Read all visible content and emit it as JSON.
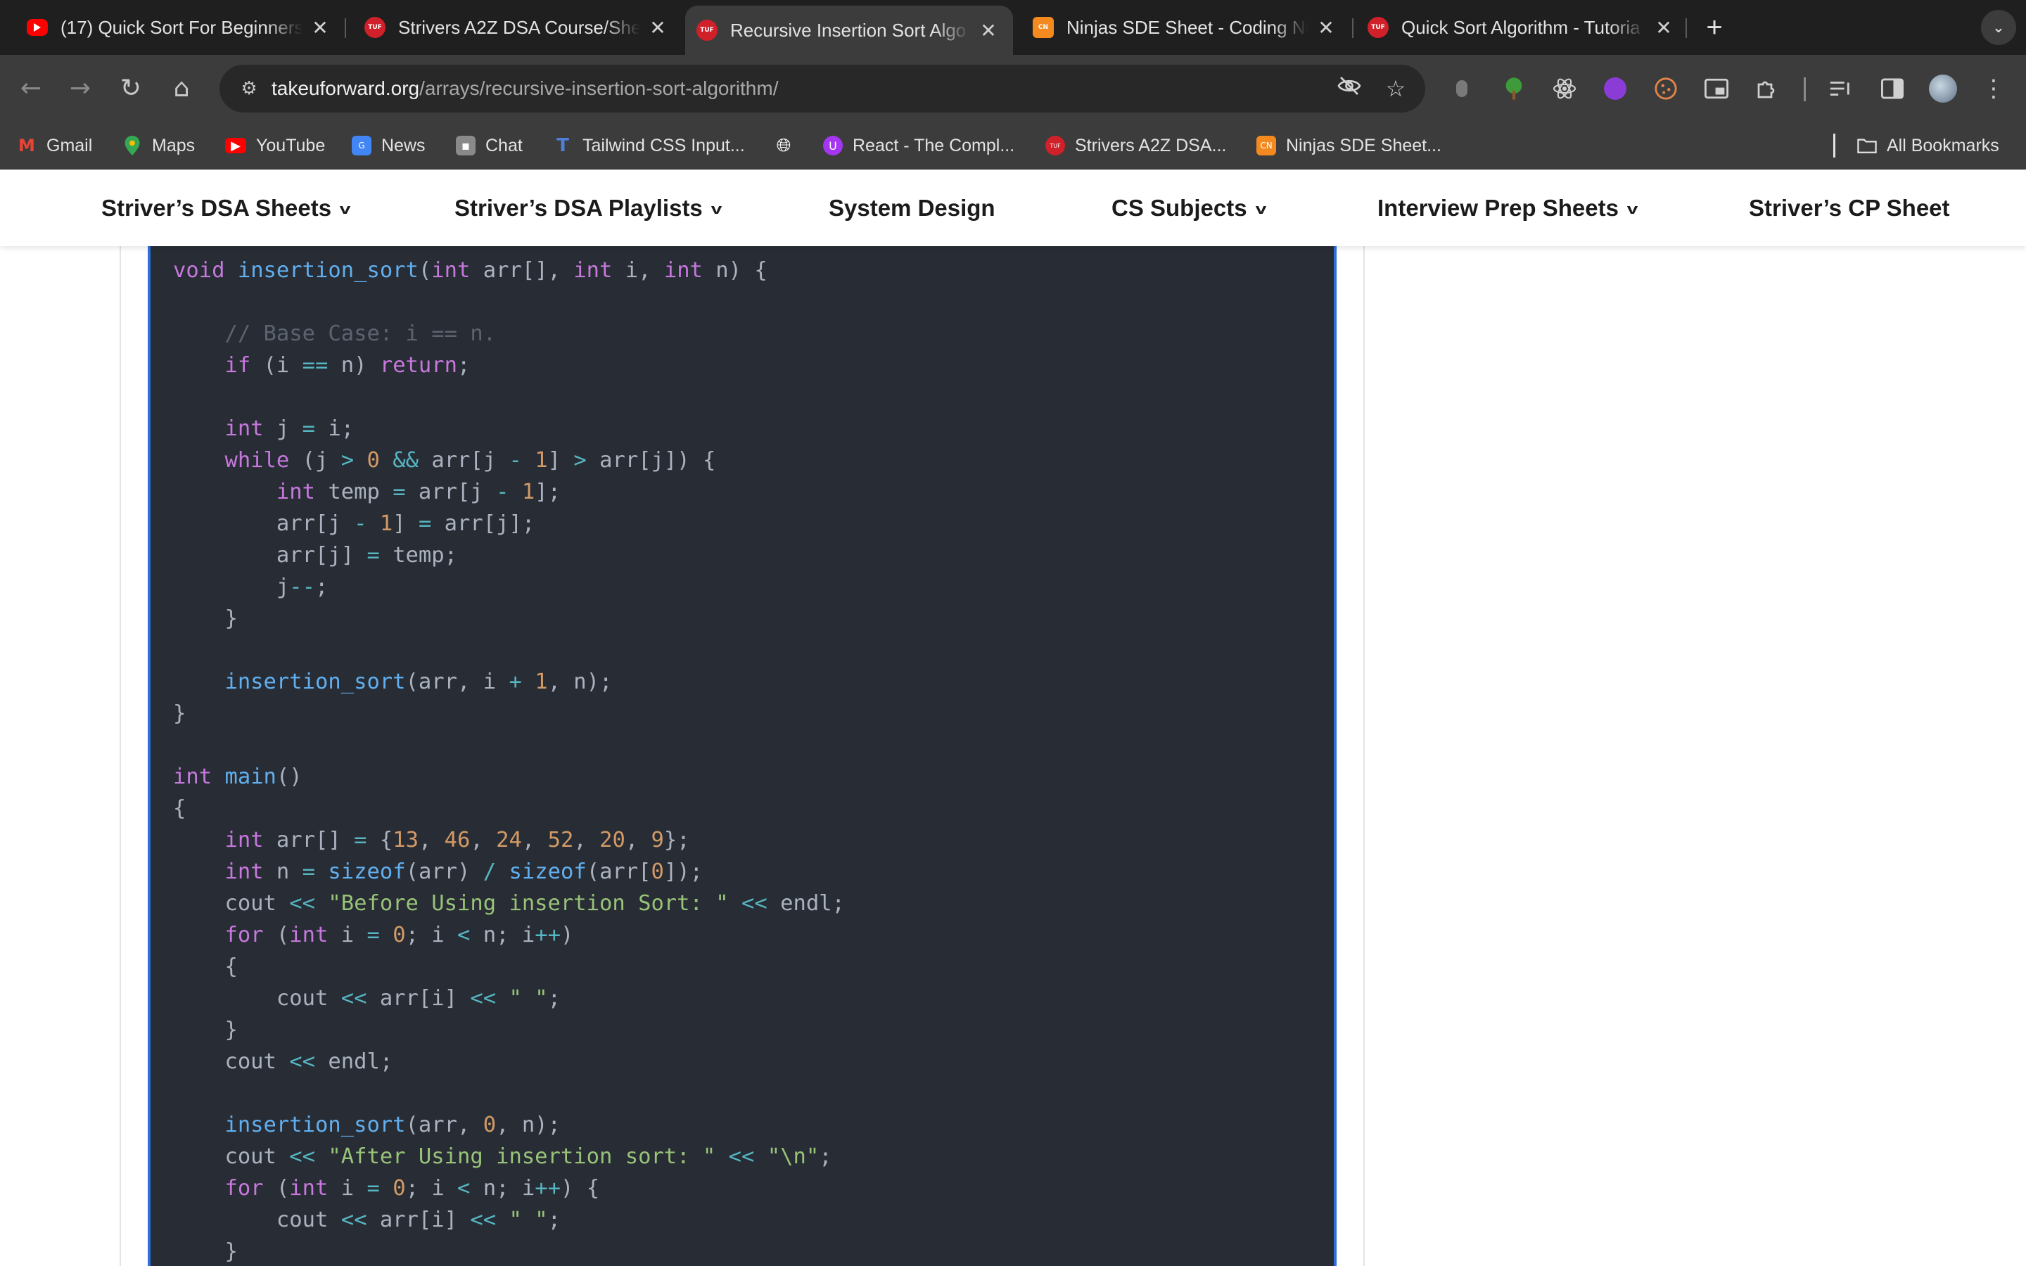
{
  "browser": {
    "tabs": [
      {
        "title": "(17) Quick Sort For Beginners",
        "favicon": "youtube-icon",
        "active": false
      },
      {
        "title": "Strivers A2Z DSA Course/She",
        "favicon": "tuf-icon",
        "active": false
      },
      {
        "title": "Recursive Insertion Sort Algo",
        "favicon": "tuf-icon",
        "active": true
      },
      {
        "title": "Ninjas SDE Sheet - Coding Ni",
        "favicon": "codingninjas-icon",
        "active": false
      },
      {
        "title": "Quick Sort Algorithm - Tutoria",
        "favicon": "tuf-icon",
        "active": false
      }
    ],
    "favicon_text": "TUF",
    "url_host": "takeuforward.org",
    "url_path": "/arrays/recursive-insertion-sort-algorithm/",
    "bookmarks": [
      {
        "label": "Gmail",
        "icon": "gmail-icon"
      },
      {
        "label": "Maps",
        "icon": "maps-icon"
      },
      {
        "label": "YouTube",
        "icon": "youtube-icon"
      },
      {
        "label": "News",
        "icon": "news-icon"
      },
      {
        "label": "Chat",
        "icon": "chat-icon"
      },
      {
        "label": "Tailwind CSS Input...",
        "icon": "tailwind-icon"
      },
      {
        "label": "",
        "icon": "globe-icon"
      },
      {
        "label": "React - The Compl...",
        "icon": "udemy-icon"
      },
      {
        "label": "Strivers A2Z DSA...",
        "icon": "tuf-icon"
      },
      {
        "label": "Ninjas SDE Sheet...",
        "icon": "codingninjas-icon"
      }
    ],
    "all_bookmarks": "All Bookmarks"
  },
  "site_nav": [
    {
      "label": "Striver’s DSA Sheets",
      "dropdown": true
    },
    {
      "label": "Striver’s DSA Playlists",
      "dropdown": true
    },
    {
      "label": "System Design",
      "dropdown": false
    },
    {
      "label": "CS Subjects",
      "dropdown": true
    },
    {
      "label": "Interview Prep Sheets",
      "dropdown": true
    },
    {
      "label": "Striver’s CP Sheet",
      "dropdown": false
    }
  ],
  "code": {
    "language": "cpp",
    "lines": [
      "void insertion_sort(int arr[], int i, int n) {",
      "",
      "    // Base Case: i == n.",
      "    if (i == n) return;",
      "",
      "    int j = i;",
      "    while (j > 0 && arr[j - 1] > arr[j]) {",
      "        int temp = arr[j - 1];",
      "        arr[j - 1] = arr[j];",
      "        arr[j] = temp;",
      "        j--;",
      "    }",
      "",
      "    insertion_sort(arr, i + 1, n);",
      "}",
      "",
      "int main()",
      "{",
      "    int arr[] = {13, 46, 24, 52, 20, 9};",
      "    int n = sizeof(arr) / sizeof(arr[0]);",
      "    cout << \"Before Using insertion Sort: \" << endl;",
      "    for (int i = 0; i < n; i++)",
      "    {",
      "        cout << arr[i] << \" \";",
      "    }",
      "    cout << endl;",
      "",
      "    insertion_sort(arr, 0, n);",
      "    cout << \"After Using insertion sort: \" << \"\\n\";",
      "    for (int i = 0; i < n; i++) {",
      "        cout << arr[i] << \" \";",
      "    }"
    ]
  },
  "colors": {
    "code_bg": "#282c34",
    "code_border": "#2f6fde",
    "keyword": "#c678dd",
    "function": "#61afef",
    "number": "#d19a66",
    "string": "#98c379",
    "comment": "#5c6370",
    "operator": "#56b6c2"
  }
}
